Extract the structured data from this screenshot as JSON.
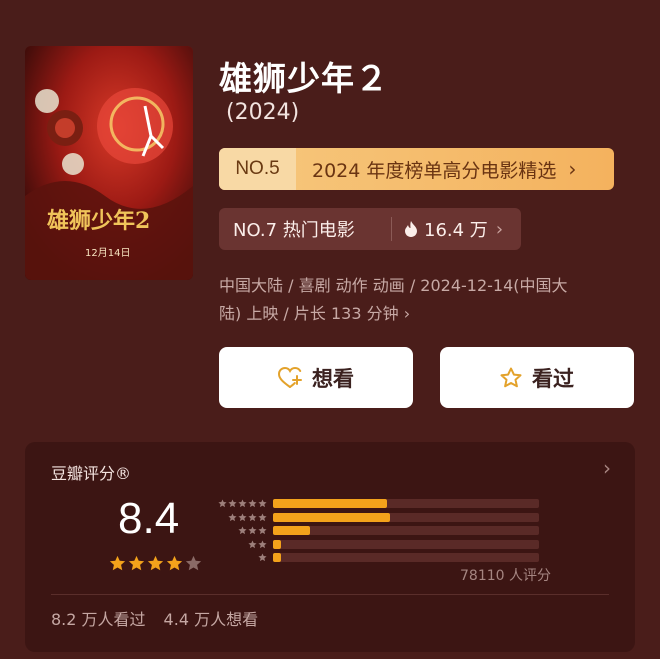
{
  "movie": {
    "title": "雄狮少年２",
    "year": "(2024)",
    "poster": {
      "title_text": "雄狮少年2",
      "date_text": "12月14日"
    },
    "rank_badge": {
      "no": "NO.5",
      "text": "2024 年度榜单高分电影精选",
      "chevron": "›"
    },
    "hot_badge": {
      "text": "NO.7 热门电影",
      "icon": "flame-icon",
      "count": "16.4 万",
      "chevron": "›"
    },
    "meta_line1": "中国大陆 / 喜剧 动作 动画 / 2024-12-14(中国大",
    "meta_line2": "陆) 上映 / 片长 133 分钟 ›"
  },
  "actions": {
    "want_label": "想看",
    "seen_label": "看过"
  },
  "rating": {
    "title": "豆瓣评分®",
    "arrow": "›",
    "score": "8.4",
    "stars_filled": 4,
    "stars_total": 5,
    "distribution": [
      {
        "stars": 5,
        "fraction": 0.43
      },
      {
        "stars": 4,
        "fraction": 0.44
      },
      {
        "stars": 3,
        "fraction": 0.14
      },
      {
        "stars": 2,
        "fraction": 0.03
      },
      {
        "stars": 1,
        "fraction": 0.03
      }
    ],
    "votes": "78110 人评分",
    "seen_count": "8.2 万人看过",
    "want_count": "4.4 万人想看"
  },
  "colors": {
    "background": "#4a1d1a",
    "accent": "#f3a21b",
    "rank_badge_bg": "#f4b25e",
    "star": "#f3a21b"
  }
}
